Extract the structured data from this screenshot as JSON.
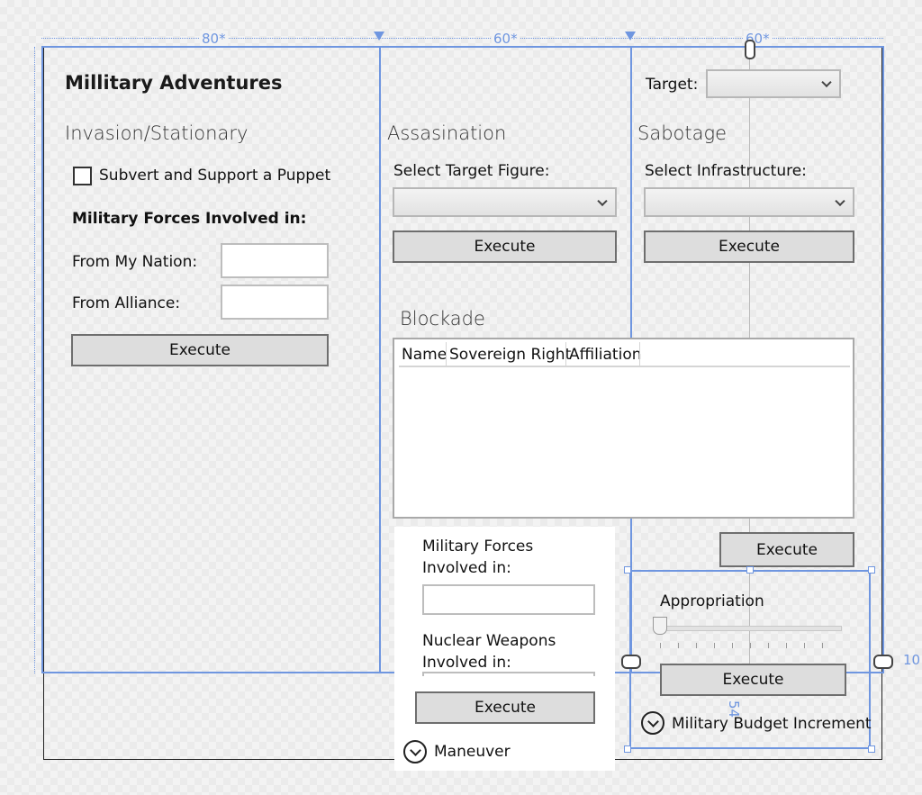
{
  "ruler": {
    "col1": "80*",
    "col2": "60*",
    "col3": "60*",
    "margin_value": "10",
    "height_value": "54"
  },
  "title": "Millitary Adventures",
  "target": {
    "label": "Target:",
    "selected": ""
  },
  "invasion": {
    "header": "Invasion/Stationary",
    "checkbox_label": "Subvert and Support a Puppet",
    "checked": false,
    "forces_header": "Military Forces Involved in:",
    "my_nation_label": "From My Nation:",
    "my_nation_value": "",
    "alliance_label": "From Alliance:",
    "alliance_value": "",
    "execute_label": "Execute"
  },
  "assassination": {
    "header": "Assasination",
    "select_label": "Select Target Figure:",
    "selected": "",
    "execute_label": "Execute"
  },
  "sabotage": {
    "header": "Sabotage",
    "select_label": "Select Infrastructure:",
    "selected": "",
    "execute_label": "Execute"
  },
  "blockade": {
    "header": "Blockade",
    "columns": [
      "Name",
      "Sovereign Right",
      "Affiliation"
    ],
    "rows": [],
    "execute_label": "Execute"
  },
  "maneuver": {
    "forces_label": "Military Forces Involved in:",
    "forces_value": "",
    "nuclear_label": "Nuclear Weapons Involved in:",
    "execute_label": "Execute",
    "expander_label": "Maneuver"
  },
  "budget": {
    "appropriation_label": "Appropriation",
    "appropriation_value": 0,
    "execute_label": "Execute",
    "expander_label": "Military Budget Increment"
  },
  "colors": {
    "accent": "#6f96e0",
    "button_bg": "#dddddd",
    "button_border": "#6e6e6e"
  }
}
